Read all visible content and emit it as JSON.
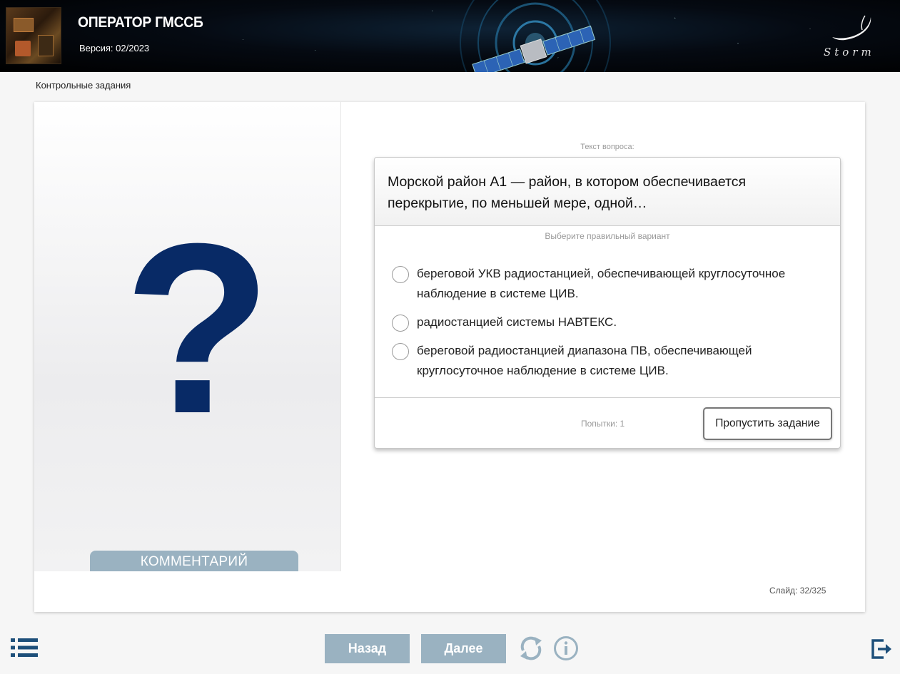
{
  "header": {
    "app_title": "ОПЕРАТОР ГМССБ",
    "version": "Версия: 02/2023",
    "logo_text": "Storm"
  },
  "breadcrumb": "Контрольные задания",
  "left_panel": {
    "symbol": "?",
    "comment_tab": "КОММЕНТАРИЙ"
  },
  "question": {
    "caption": "Текст вопроса:",
    "text": "Морской район А1 — район, в котором обеспечивается перекрытие, по меньшей мере, одной…",
    "hint": "Выберите правильный вариант",
    "options": [
      {
        "label": "береговой УКВ радиостанцией, обеспечивающей круглосуточное наблюдение в системе ЦИВ.",
        "selected": false
      },
      {
        "label": "радиостанцией системы НАВТЕКС.",
        "selected": false
      },
      {
        "label": "береговой радиостанцией диапазона ПВ, обеспечивающей круглосуточное наблюдение в системе ЦИВ.",
        "selected": false
      }
    ],
    "attempts": "Попытки: 1",
    "skip_label": "Пропустить задание"
  },
  "slide_counter": "Слайд: 32/325",
  "nav": {
    "back_label": "Назад",
    "next_label": "Далее"
  },
  "colors": {
    "accent": "#9ab2c1",
    "question_mark": "#082a66",
    "header_bg": "#000000"
  },
  "icons": {
    "menu": "list-menu-icon",
    "reload": "reload-icon",
    "info": "info-icon",
    "exit": "exit-icon"
  }
}
